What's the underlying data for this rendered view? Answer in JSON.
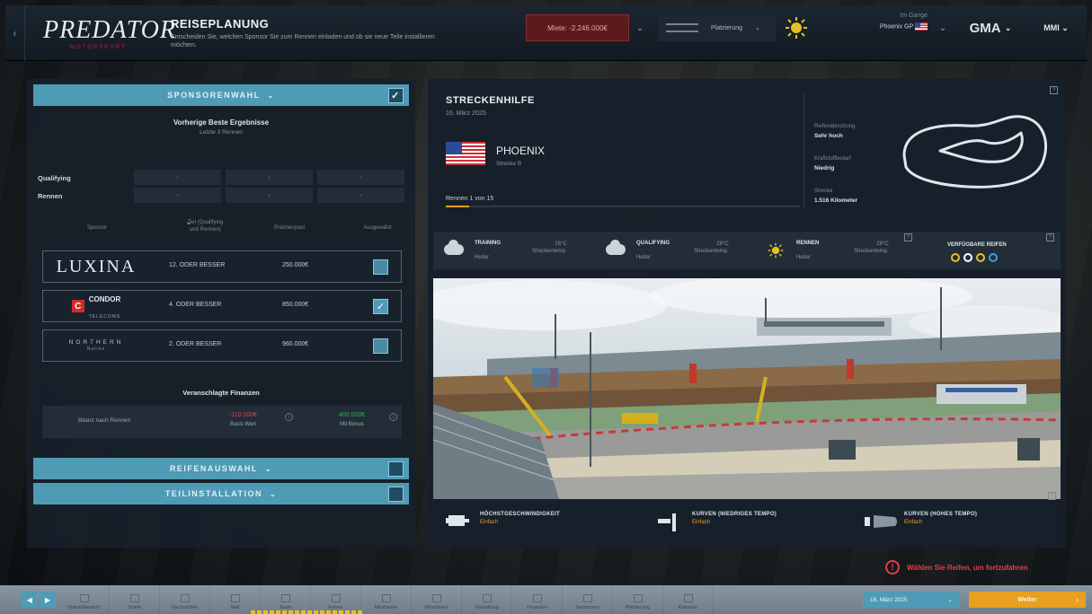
{
  "header": {
    "logo_text": "PREDATOR",
    "logo_sub": "MOTORSPORT",
    "title": "REISEPLANUNG",
    "description": "Entscheiden Sie, welchen Sponsor Sie zum Rennen einladen und ob sie neue Teile installieren möchten.",
    "money": "Miete: -2.246.000€",
    "standing_label": "Platzierung",
    "next_label": "Im Gange",
    "next_value": "Phoenix GP",
    "team_short": "GMA",
    "user_short": "MMI"
  },
  "sponsor_panel": {
    "header": "SPONSORENWAHL",
    "subtitle": "Vorherige Beste Ergebnisse",
    "subtitle2": "Letzte 3 Rennen",
    "row_labels": [
      "Qualifying",
      "Rennen"
    ],
    "cells": [
      "-",
      "-",
      "-"
    ],
    "col_headers": [
      "Sponsor",
      "Ziel (Qualifying und Rennen)",
      "Prämienpool",
      "Ausgewählt"
    ],
    "sponsors": [
      {
        "name": "LUXINA",
        "target": "12. ODER BESSER",
        "prize": "250.000€",
        "selected": false
      },
      {
        "name": "CONDOR",
        "name_sub": "TELECOMS",
        "target": "4. ODER BESSER",
        "prize": "850.000€",
        "selected": true
      },
      {
        "name": "NORTHERN",
        "name_sub": "Nation",
        "target": "2. ODER BESSER",
        "prize": "960.000€",
        "selected": false
      }
    ],
    "finance_title": "Veranschlagte Finanzen",
    "finance_label": "Bilanz nach Rennen",
    "finance_neg": "-110.000€",
    "finance_neg_sub": "Basis Wert",
    "finance_pos": "400.000€",
    "finance_pos_sub": "Mit Bonus"
  },
  "accordions": {
    "tyres": "REIFENAUSWAHL",
    "parts": "TEILINSTALLATION"
  },
  "track": {
    "title": "STRECKENHILFE",
    "date": "16. März 2025",
    "name": "PHOENIX",
    "layout": "Strecke B",
    "race_count": "Rennen 1 von 15",
    "race_progress": 0.067,
    "stats": [
      {
        "label": "Reifenabnutzung",
        "value": "Sehr hoch"
      },
      {
        "label": "Kraftstoffbedarf",
        "value": "Niedrig"
      },
      {
        "label": "Strecke",
        "value": "1.516 Kilometer"
      }
    ]
  },
  "weather": [
    {
      "session": "TRAINING",
      "desc": "Heiter",
      "temp": "28°C",
      "track": "Streckentemp."
    },
    {
      "session": "QUALIFYING",
      "desc": "Heiter",
      "temp": "28°C",
      "track": "Streckentemp."
    },
    {
      "session": "RENNEN",
      "desc": "Heiter",
      "temp": "28°C",
      "track": "Streckentemp."
    }
  ],
  "tyres_label": "VERFÜGBARE REIFEN",
  "tyre_colors": [
    "#e8c020",
    "#ffffff",
    "#e8c020",
    "#3aa0e0"
  ],
  "corners": [
    {
      "title": "HÖCHSTGESCHWINDIGKEIT",
      "status": "Einfach"
    },
    {
      "title": "KURVEN (NIEDRIGES TEMPO)",
      "status": "Einfach"
    },
    {
      "title": "KURVEN (HOHES TEMPO)",
      "status": "Einfach"
    }
  ],
  "footer": {
    "warning": "Wählen Sie Reifen, um fortzufahren",
    "nav_items": [
      "Standübersicht",
      "Spiele",
      "Nachrichten",
      "Mail",
      "Team",
      "Fahrer",
      "Mitarbeiter",
      "Mitarbeiter",
      "Gestaltung",
      "Finanzen",
      "Sponsoren",
      "Platzierung",
      "Kalender"
    ],
    "date": "16. März 2025",
    "continue": "Weiter"
  }
}
